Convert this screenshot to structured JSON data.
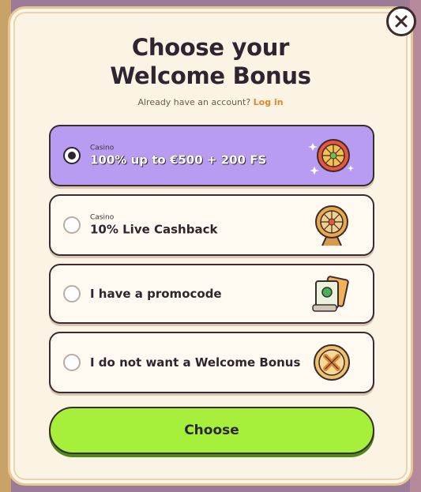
{
  "modal": {
    "title_line1": "Choose your",
    "title_line2": "Welcome Bonus",
    "subtitle_prefix": "Already have an account?",
    "login_link": "Log in",
    "close_icon": "close-icon"
  },
  "options": [
    {
      "category": "Casino",
      "label": "100% up to €500 + 200 FS",
      "selected": true,
      "icon": "wheel-sparkles-icon"
    },
    {
      "category": "Casino",
      "label": "10% Live Cashback",
      "selected": false,
      "icon": "wheel-icon"
    },
    {
      "category": "",
      "label": "I have a promocode",
      "selected": false,
      "icon": "promocode-card-icon"
    },
    {
      "category": "",
      "label": "I do not want a Welcome Bonus",
      "selected": false,
      "icon": "no-bonus-coin-icon"
    }
  ],
  "choose_button": "Choose",
  "colors": {
    "selected_bg": "#b79cf2",
    "button_bg": "#a6f03b",
    "login_link": "#e0862b",
    "panel_bg": "#fbf3e3"
  }
}
